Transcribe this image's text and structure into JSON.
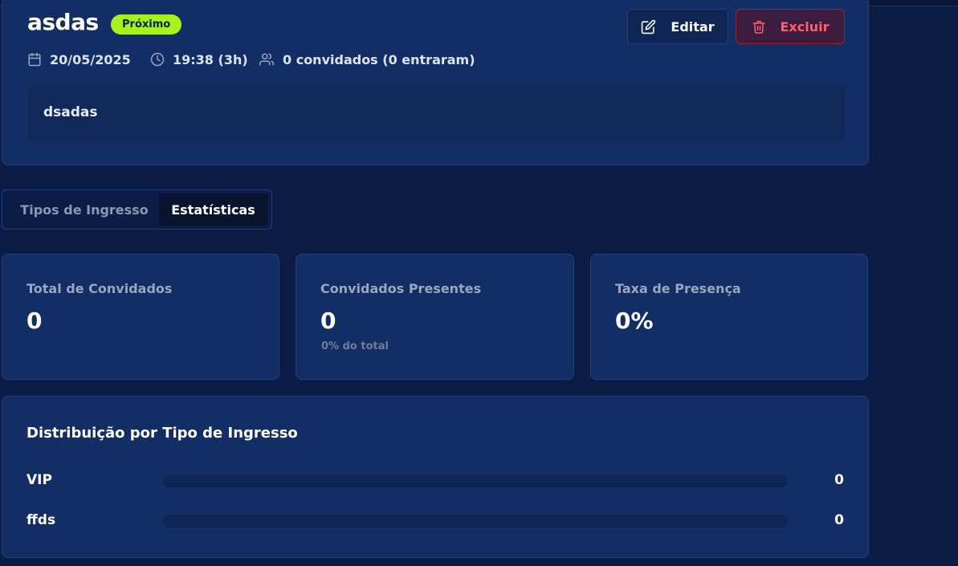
{
  "event": {
    "title": "asdas",
    "status_badge": "Próximo",
    "date": "20/05/2025",
    "time": "19:38 (3h)",
    "guests": "0 convidados (0 entraram)",
    "description": "dsadas",
    "edit_label": "Editar",
    "delete_label": "Excluir"
  },
  "tabs": [
    {
      "label": "Tipos de Ingresso",
      "active": false
    },
    {
      "label": "Estatísticas",
      "active": true
    }
  ],
  "stats": [
    {
      "label": "Total de Convidados",
      "value": "0",
      "sub": ""
    },
    {
      "label": "Convidados Presentes",
      "value": "0",
      "sub": "0% do total"
    },
    {
      "label": "Taxa de Presença",
      "value": "0%",
      "sub": ""
    }
  ],
  "distribution": {
    "title": "Distribuição por Tipo de Ingresso",
    "rows": [
      {
        "name": "VIP",
        "count": "0",
        "fraction": 0
      },
      {
        "name": "ffds",
        "count": "0",
        "fraction": 0
      }
    ]
  },
  "colors": {
    "background": "#0c1d45",
    "card": "#132e64",
    "accent": "#a6f21e",
    "danger": "#ff5f68"
  },
  "icons": {
    "date": "calendar-icon",
    "time": "clock-icon",
    "guests": "users-icon",
    "edit": "pencil-square-icon",
    "delete": "trash-icon"
  }
}
